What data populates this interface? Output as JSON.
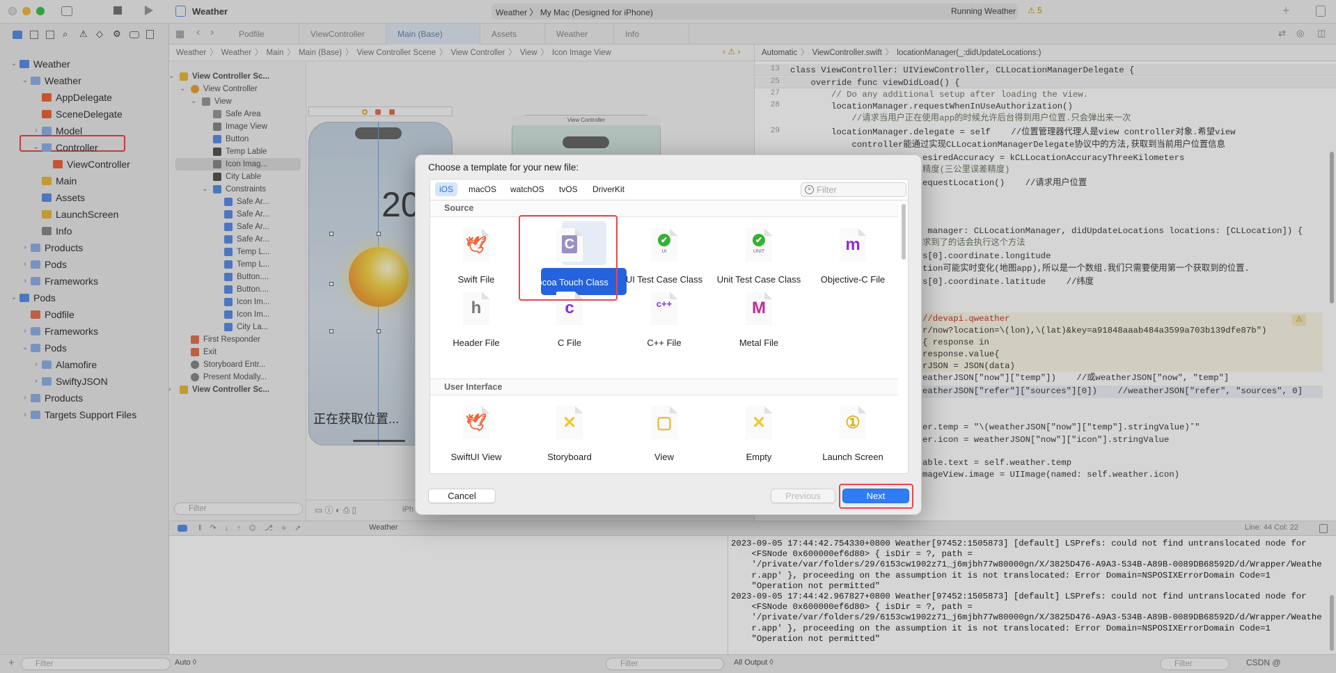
{
  "window": {
    "title": "Weather",
    "scheme": "Weather",
    "destination": "My Mac (Designed for iPhone)",
    "status": "Running Weather",
    "warnings": "5"
  },
  "tabs": [
    {
      "label": "Podfile"
    },
    {
      "label": "ViewController"
    },
    {
      "label": "Main (Base)",
      "active": true
    },
    {
      "label": "Assets"
    },
    {
      "label": "Weather"
    },
    {
      "label": "Info"
    }
  ],
  "breadcrumb": [
    "Weather",
    "Weather",
    "Main",
    "Main (Base)",
    "View Controller Scene",
    "View Controller",
    "View",
    "Icon Image View"
  ],
  "editor_breadcrumb": [
    "Automatic",
    "ViewController.swift",
    "locationManager(_:didUpdateLocations:)"
  ],
  "navigator": [
    {
      "label": "Weather",
      "level": 0,
      "chev": "v",
      "kind": "project"
    },
    {
      "label": "Weather",
      "level": 1,
      "chev": "v",
      "kind": "folder"
    },
    {
      "label": "AppDelegate",
      "level": 2,
      "kind": "swift"
    },
    {
      "label": "SceneDelegate",
      "level": 2,
      "kind": "swift"
    },
    {
      "label": "Model",
      "level": 2,
      "chev": ">",
      "kind": "folder"
    },
    {
      "label": "Controller",
      "level": 2,
      "chev": "v",
      "kind": "folder",
      "highlighted": true
    },
    {
      "label": "ViewController",
      "level": 3,
      "kind": "swift"
    },
    {
      "label": "Main",
      "level": 2,
      "kind": "storyboard"
    },
    {
      "label": "Assets",
      "level": 2,
      "kind": "assets"
    },
    {
      "label": "LaunchScreen",
      "level": 2,
      "kind": "storyboard"
    },
    {
      "label": "Info",
      "level": 2,
      "kind": "plist"
    },
    {
      "label": "Products",
      "level": 1,
      "chev": ">",
      "kind": "folder"
    },
    {
      "label": "Pods",
      "level": 1,
      "chev": ">",
      "kind": "folder"
    },
    {
      "label": "Frameworks",
      "level": 1,
      "chev": ">",
      "kind": "folder"
    },
    {
      "label": "Pods",
      "level": 0,
      "chev": "v",
      "kind": "project"
    },
    {
      "label": "Podfile",
      "level": 1,
      "kind": "podfile"
    },
    {
      "label": "Frameworks",
      "level": 1,
      "chev": ">",
      "kind": "folder"
    },
    {
      "label": "Pods",
      "level": 1,
      "chev": "v",
      "kind": "folder"
    },
    {
      "label": "Alamofire",
      "level": 2,
      "chev": ">",
      "kind": "folder"
    },
    {
      "label": "SwiftyJSON",
      "level": 2,
      "chev": ">",
      "kind": "folder"
    },
    {
      "label": "Products",
      "level": 1,
      "chev": ">",
      "kind": "folder"
    },
    {
      "label": "Targets Support Files",
      "level": 1,
      "chev": ">",
      "kind": "folder"
    }
  ],
  "navigator_filter": "Filter",
  "outline": [
    {
      "label": "View Controller Sc...",
      "level": 0,
      "chev": "v",
      "kind": "scene",
      "bold": true
    },
    {
      "label": "View Controller",
      "level": 1,
      "chev": "v",
      "kind": "vc"
    },
    {
      "label": "View",
      "level": 2,
      "chev": "v",
      "kind": "view"
    },
    {
      "label": "Safe Area",
      "level": 3,
      "kind": "view"
    },
    {
      "label": "Image View",
      "level": 3,
      "kind": "image"
    },
    {
      "label": "Button",
      "level": 3,
      "kind": "button"
    },
    {
      "label": "Temp Lable",
      "level": 3,
      "kind": "label"
    },
    {
      "label": "Icon Imag...",
      "level": 3,
      "kind": "image",
      "selected": true
    },
    {
      "label": "City Lable",
      "level": 3,
      "kind": "label"
    },
    {
      "label": "Constraints",
      "level": 3,
      "chev": "v",
      "kind": "constraint"
    },
    {
      "label": "Safe Ar...",
      "level": 4,
      "kind": "constraint"
    },
    {
      "label": "Safe Ar...",
      "level": 4,
      "kind": "constraint"
    },
    {
      "label": "Safe Ar...",
      "level": 4,
      "kind": "constraint"
    },
    {
      "label": "Safe Ar...",
      "level": 4,
      "kind": "constraint"
    },
    {
      "label": "Temp L...",
      "level": 4,
      "kind": "constraint"
    },
    {
      "label": "Temp L...",
      "level": 4,
      "kind": "constraint"
    },
    {
      "label": "Button....",
      "level": 4,
      "kind": "constraint"
    },
    {
      "label": "Button....",
      "level": 4,
      "kind": "constraint"
    },
    {
      "label": "Icon Im...",
      "level": 4,
      "kind": "constraint"
    },
    {
      "label": "Icon Im...",
      "level": 4,
      "kind": "constraint"
    },
    {
      "label": "City La...",
      "level": 4,
      "kind": "constraint"
    },
    {
      "label": "First Responder",
      "level": 1,
      "kind": "responder"
    },
    {
      "label": "Exit",
      "level": 1,
      "kind": "exit"
    },
    {
      "label": "Storyboard Entr...",
      "level": 1,
      "kind": "entry"
    },
    {
      "label": "Present Modally...",
      "level": 1,
      "kind": "segue"
    },
    {
      "label": "View Controller Sc...",
      "level": 0,
      "chev": ">",
      "kind": "scene",
      "bold": true
    }
  ],
  "outline_filter": "Filter",
  "canvas": {
    "temp_text": "20",
    "location_text": "正在获取位置...",
    "second_scene_title": "View Controller",
    "device_label": "iPh"
  },
  "code": {
    "line_numbers": [
      "13",
      "25",
      "27",
      "28",
      "29"
    ],
    "lines": [
      "class ViewController: UIViewController, CLLocationManagerDelegate {",
      "    override func viewDidLoad() {",
      "        // Do any additional setup after loading the view.",
      "        locationManager.requestWhenInUseAuthorization()",
      "            //请求当用户正在使用app的时候允许后台得到用户位置.只会弹出来一次",
      "        locationManager.delegate = self    //位置管理器代理人是view controller对象.希望view",
      "            controller能通过实现CLLocationManagerDelegate协议中的方法,获取到当前用户位置信息",
      "esiredAccuracy = kCLLocationAccuracyThreeKilometers",
      "精度(三公里误差精度)",
      "equestLocation()    //请求用户位置",
      " manager: CLLocationManager, didUpdateLocations locations: [CLLocation]) {",
      "求到了的话会执行这个方法",
      "s[0].coordinate.longitude",
      "tion可能实时变化(地图app),所以是一个数组.我们只需要使用第一个获取到的位置.",
      "s[0].coordinate.latitude    //纬度",
      "//devapi.qweather",
      "r/now?location=\\(lon),\\(lat)&key=a91848aaab484a3599a703b139dfe87b\")",
      "{ response in",
      "response.value{",
      "rJSON = JSON(data)",
      "eatherJSON[\"now\"][\"temp\"])    //或weatherJSON[\"now\", \"temp\"]",
      "eatherJSON[\"refer\"][\"sources\"][0])    //weatherJSON[\"refer\", \"sources\", 0]",
      "er.temp = \"\\(weatherJSON[\"now\"][\"temp\"].stringValue)˚\"",
      "er.icon = weatherJSON[\"now\"][\"icon\"].stringValue",
      "able.text = self.weather.temp",
      "mageView.image = UIImage(named: self.weather.icon)"
    ],
    "position": "Line: 44  Col: 22"
  },
  "debug": {
    "target": "Weather",
    "auto_label": "Auto ◊",
    "output_label": "All Output ◊",
    "filter": "Filter"
  },
  "console": [
    "2023-09-05 17:44:42.754330+0800 Weather[97452:1505873] [default] LSPrefs: could not find untranslocated node for",
    "    <FSNode 0x600000ef6d80> { isDir = ?, path =",
    "    '/private/var/folders/29/6153cw1902z71_j6mjbh77w80000gn/X/3825D476-A9A3-534B-A89B-0089DB68592D/d/Wrapper/Weathe",
    "    r.app' }, proceeding on the assumption it is not translocated: Error Domain=NSPOSIXErrorDomain Code=1",
    "    \"Operation not permitted\"",
    "2023-09-05 17:44:42.967827+0800 Weather[97452:1505873] [default] LSPrefs: could not find untranslocated node for",
    "    <FSNode 0x600000ef6d80> { isDir = ?, path =",
    "    '/private/var/folders/29/6153cw1902z71_j6mjbh77w80000gn/X/3825D476-A9A3-534B-A89B-0089DB68592D/d/Wrapper/Weathe",
    "    r.app' }, proceeding on the assumption it is not translocated: Error Domain=NSPOSIXErrorDomain Code=1",
    "    \"Operation not permitted\""
  ],
  "watermark": "CSDN @",
  "dialog": {
    "title": "Choose a template for your new file:",
    "platforms": [
      {
        "label": "iOS",
        "selected": true
      },
      {
        "label": "macOS"
      },
      {
        "label": "watchOS"
      },
      {
        "label": "tvOS"
      },
      {
        "label": "DriverKit"
      }
    ],
    "filter_placeholder": "Filter",
    "sections": [
      {
        "title": "Source",
        "templates": [
          {
            "label": "Swift File",
            "icon": "swift-icon"
          },
          {
            "label": "Cocoa Touch Class",
            "icon": "cocoa-class-icon",
            "selected": true
          },
          {
            "label": "UI Test Case Class",
            "icon": "ui-test-icon"
          },
          {
            "label": "Unit Test Case Class",
            "icon": "unit-test-icon"
          },
          {
            "label": "Objective-C File",
            "icon": "objc-icon"
          },
          {
            "label": "Header File",
            "icon": "header-icon"
          },
          {
            "label": "C File",
            "icon": "c-file-icon"
          },
          {
            "label": "C++ File",
            "icon": "cpp-file-icon"
          },
          {
            "label": "Metal File",
            "icon": "metal-icon"
          }
        ]
      },
      {
        "title": "User Interface",
        "templates": [
          {
            "label": "SwiftUI View",
            "icon": "swift-icon"
          },
          {
            "label": "Storyboard",
            "icon": "storyboard-icon"
          },
          {
            "label": "View",
            "icon": "view-icon"
          },
          {
            "label": "Empty",
            "icon": "empty-icon"
          },
          {
            "label": "Launch Screen",
            "icon": "launch-screen-icon"
          }
        ]
      }
    ],
    "cancel": "Cancel",
    "previous": "Previous",
    "next": "Next"
  },
  "colors": {
    "accent": "#2563de",
    "highlight": "#e5484d",
    "warning": "#e0a800"
  }
}
